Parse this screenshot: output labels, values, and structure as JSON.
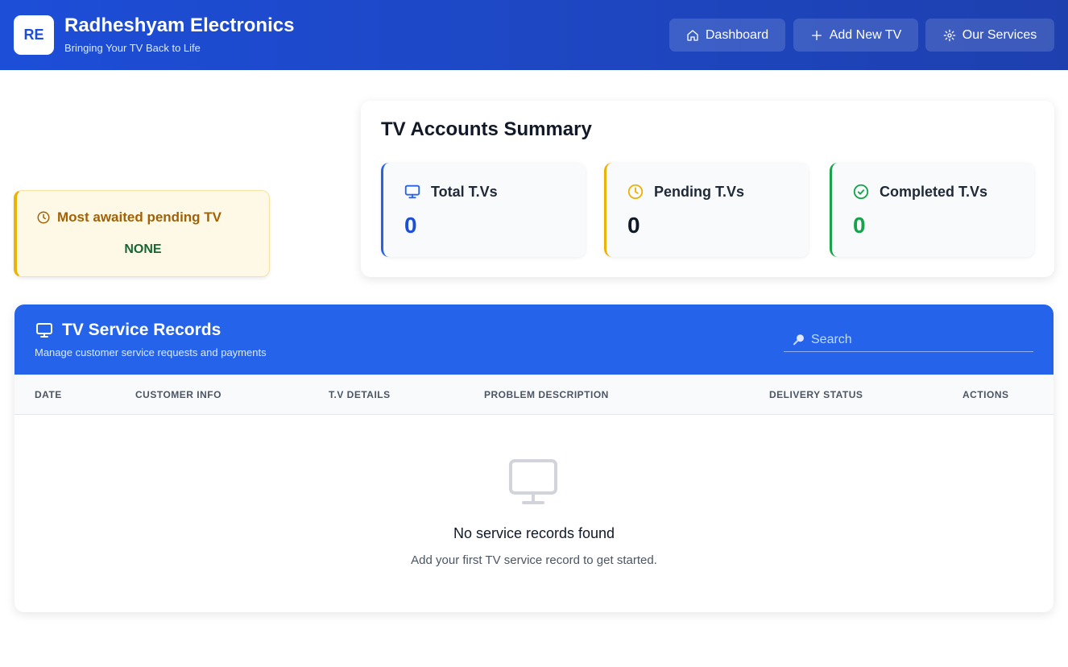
{
  "header": {
    "logo_initials": "RE",
    "title": "Radheshyam Electronics",
    "subtitle": "Bringing Your TV Back to Life",
    "nav": {
      "dashboard": "Dashboard",
      "add_tv": "Add New TV",
      "services": "Our Services"
    }
  },
  "pending_card": {
    "title": "Most awaited pending TV",
    "value": "NONE",
    "accent": "#eab308"
  },
  "summary": {
    "title": "TV Accounts Summary",
    "stats": [
      {
        "label": "Total T.Vs",
        "value": "0",
        "color": "#1d4ed8",
        "icon": "monitor-icon"
      },
      {
        "label": "Pending T.Vs",
        "value": "0",
        "color": "#111827",
        "icon": "clock-icon"
      },
      {
        "label": "Completed T.Vs",
        "value": "0",
        "color": "#16a34a",
        "icon": "check-circle-icon"
      }
    ]
  },
  "records": {
    "title": "TV Service Records",
    "subtitle": "Manage customer service requests and payments",
    "search_placeholder": "Search",
    "columns": [
      "DATE",
      "CUSTOMER INFO",
      "T.V DETAILS",
      "PROBLEM DESCRIPTION",
      "DELIVERY STATUS",
      "ACTIONS"
    ],
    "empty_title": "No service records found",
    "empty_subtitle": "Add your first TV service record to get started."
  },
  "colors": {
    "brand": "#1d4ed8",
    "records_header": "#2563eb",
    "pending_bg": "#fef9e7",
    "success": "#16a34a"
  }
}
